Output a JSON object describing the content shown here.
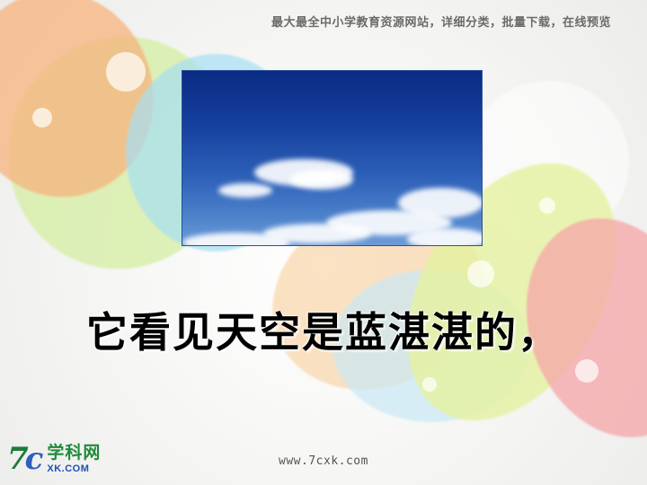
{
  "header": {
    "tagline": "最大最全中小学教育资源网站，详细分类，批量下载，在线预览"
  },
  "main": {
    "caption": "它看见天空是蓝湛湛的，"
  },
  "footer": {
    "logo_mark_7": "7",
    "logo_mark_c": "c",
    "logo_cn": "学科网",
    "logo_en": "XK.COM",
    "url": "www.7cxk.com"
  },
  "colors": {
    "sky_top": "#0a2b83",
    "sky_bottom": "#6d9bd6",
    "logo_green": "#1f8b3b",
    "logo_blue": "#1f4fb3"
  }
}
